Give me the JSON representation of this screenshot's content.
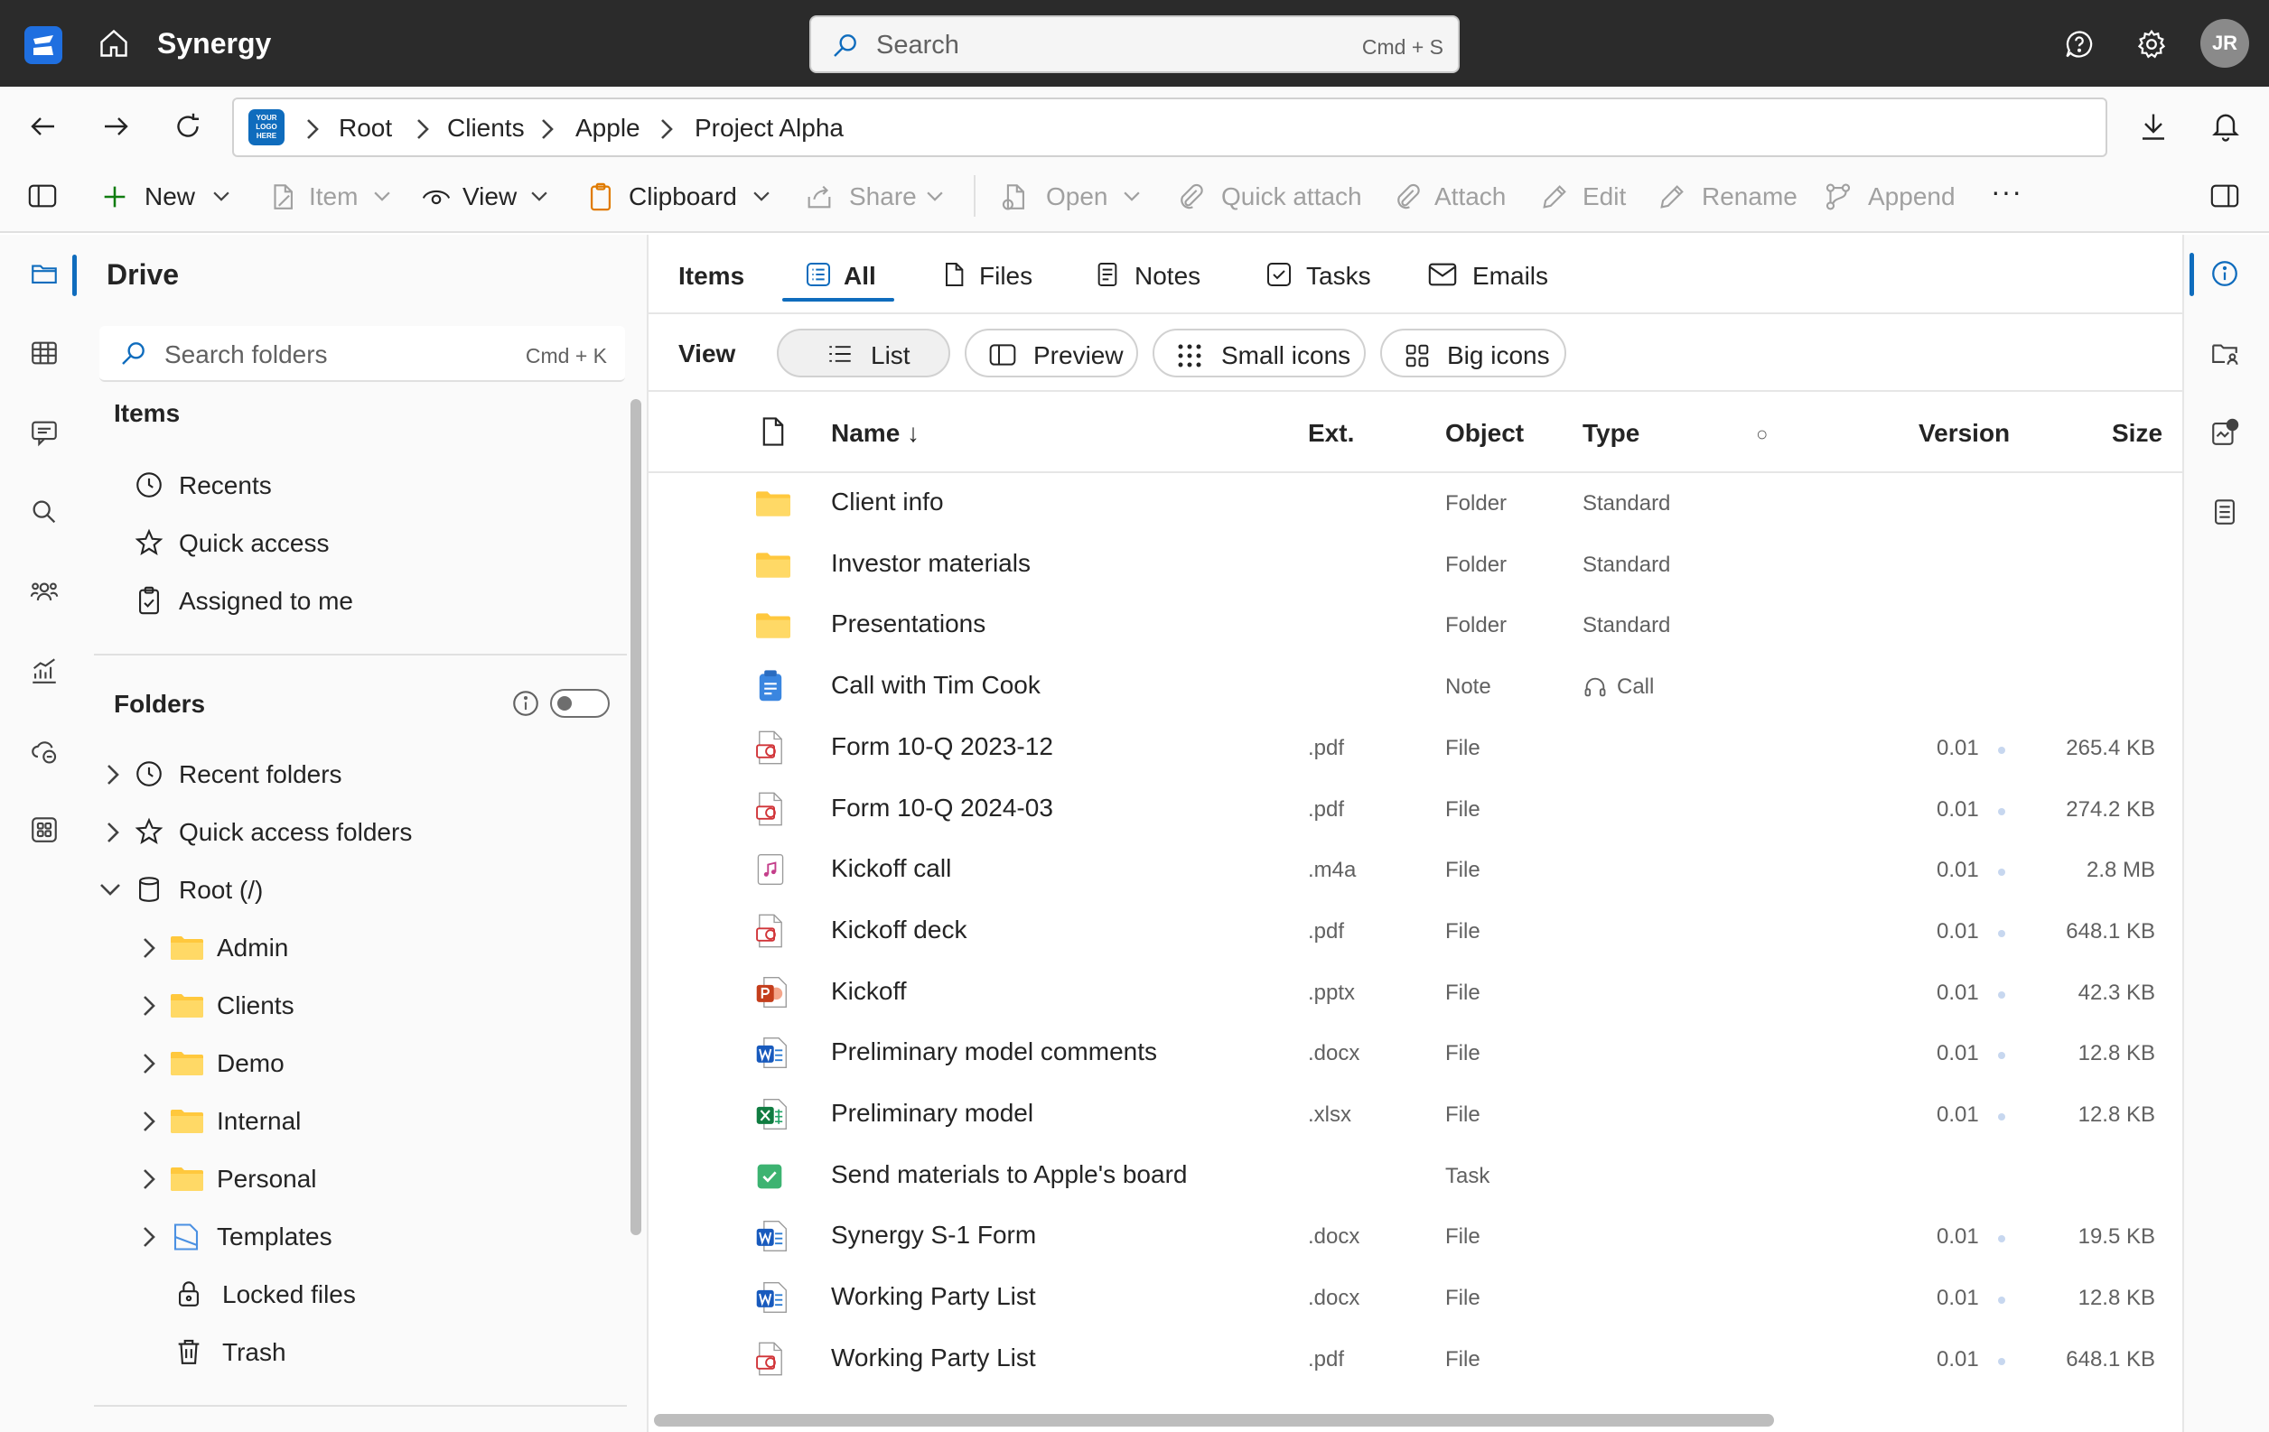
{
  "app": {
    "title": "Synergy",
    "avatar_initials": "JR",
    "accent": "#0f6cbd"
  },
  "search": {
    "placeholder": "Search",
    "shortcut": "Cmd + S"
  },
  "breadcrumb": {
    "logo_text": "YOUR LOGO HERE",
    "items": [
      "Root",
      "Clients",
      "Apple",
      "Project Alpha"
    ]
  },
  "toolbar": {
    "new": "New",
    "item": "Item",
    "view": "View",
    "clipboard": "Clipboard",
    "share": "Share",
    "open": "Open",
    "quick_attach": "Quick attach",
    "attach": "Attach",
    "edit": "Edit",
    "rename": "Rename",
    "append": "Append",
    "more": "···"
  },
  "drive": {
    "title": "Drive",
    "search_placeholder": "Search folders",
    "search_shortcut": "Cmd + K",
    "items_heading": "Items",
    "items": [
      "Recents",
      "Quick access",
      "Assigned to me"
    ],
    "folders_heading": "Folders",
    "folders_toggle_on": false,
    "tree": {
      "recent_folders": "Recent folders",
      "quick_access_folders": "Quick access folders",
      "root": "Root (/)",
      "children": [
        "Admin",
        "Clients",
        "Demo",
        "Internal",
        "Personal",
        "Templates"
      ],
      "locked": "Locked files",
      "trash": "Trash"
    }
  },
  "tabs": {
    "label": "Items",
    "items": [
      "All",
      "Files",
      "Notes",
      "Tasks",
      "Emails"
    ],
    "active": "All"
  },
  "view": {
    "label": "View",
    "options": [
      "List",
      "Preview",
      "Small icons",
      "Big icons"
    ],
    "active": "List"
  },
  "table": {
    "columns": {
      "name": "Name ↓",
      "ext": "Ext.",
      "object": "Object",
      "type": "Type",
      "status": "○",
      "version": "Version",
      "size": "Size"
    },
    "rows": [
      {
        "icon": "folder-icon",
        "name": "Client info",
        "ext": "",
        "object": "Folder",
        "type": "Standard",
        "version": "",
        "size": ""
      },
      {
        "icon": "folder-icon",
        "name": "Investor materials",
        "ext": "",
        "object": "Folder",
        "type": "Standard",
        "version": "",
        "size": ""
      },
      {
        "icon": "folder-icon",
        "name": "Presentations",
        "ext": "",
        "object": "Folder",
        "type": "Standard",
        "version": "",
        "size": ""
      },
      {
        "icon": "note-icon",
        "name": "Call with Tim Cook",
        "ext": "",
        "object": "Note",
        "type": "Call",
        "version": "",
        "size": ""
      },
      {
        "icon": "pdf-icon",
        "name": "Form 10-Q 2023-12",
        "ext": ".pdf",
        "object": "File",
        "type": "",
        "version": "0.01",
        "size": "265.4 KB"
      },
      {
        "icon": "pdf-icon",
        "name": "Form 10-Q 2024-03",
        "ext": ".pdf",
        "object": "File",
        "type": "",
        "version": "0.01",
        "size": "274.2 KB"
      },
      {
        "icon": "audio-icon",
        "name": "Kickoff call",
        "ext": ".m4a",
        "object": "File",
        "type": "",
        "version": "0.01",
        "size": "2.8 MB"
      },
      {
        "icon": "pdf-icon",
        "name": "Kickoff deck",
        "ext": ".pdf",
        "object": "File",
        "type": "",
        "version": "0.01",
        "size": "648.1 KB"
      },
      {
        "icon": "powerpoint-icon",
        "name": "Kickoff",
        "ext": ".pptx",
        "object": "File",
        "type": "",
        "version": "0.01",
        "size": "42.3 KB"
      },
      {
        "icon": "word-icon",
        "name": "Preliminary model comments",
        "ext": ".docx",
        "object": "File",
        "type": "",
        "version": "0.01",
        "size": "12.8 KB"
      },
      {
        "icon": "excel-icon",
        "name": "Preliminary model",
        "ext": ".xlsx",
        "object": "File",
        "type": "",
        "version": "0.01",
        "size": "12.8 KB"
      },
      {
        "icon": "task-icon",
        "name": "Send materials to Apple's board",
        "ext": "",
        "object": "Task",
        "type": "",
        "version": "",
        "size": ""
      },
      {
        "icon": "word-icon",
        "name": "Synergy S-1 Form",
        "ext": ".docx",
        "object": "File",
        "type": "",
        "version": "0.01",
        "size": "19.5 KB"
      },
      {
        "icon": "word-icon",
        "name": "Working Party List",
        "ext": ".docx",
        "object": "File",
        "type": "",
        "version": "0.01",
        "size": "12.8 KB"
      },
      {
        "icon": "pdf-icon",
        "name": "Working Party List",
        "ext": ".pdf",
        "object": "File",
        "type": "",
        "version": "0.01",
        "size": "648.1 KB"
      }
    ]
  }
}
